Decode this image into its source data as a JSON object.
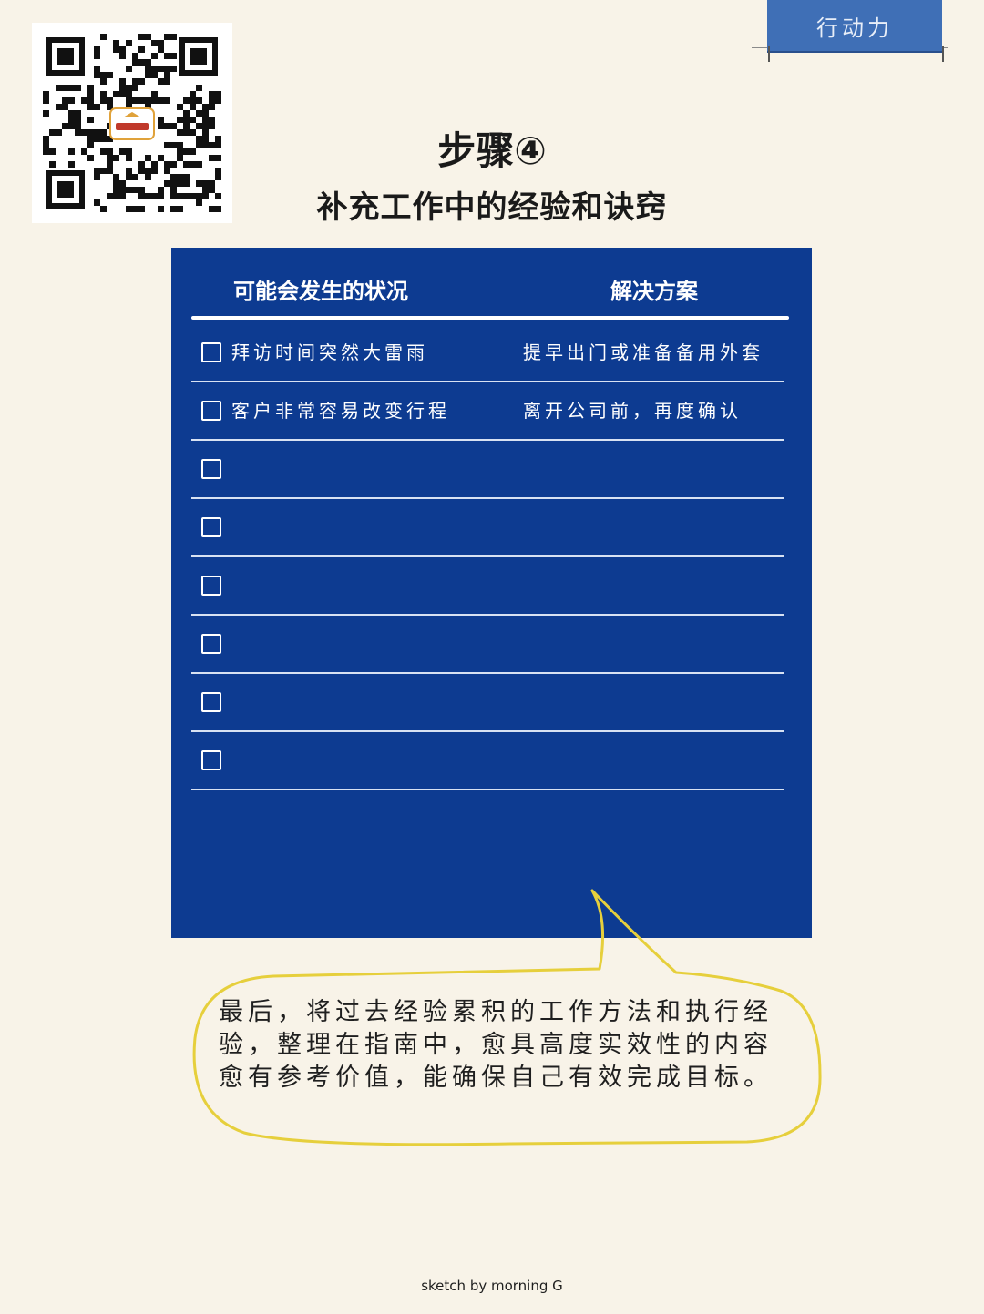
{
  "tag": {
    "label": "行动力"
  },
  "header": {
    "title": "步骤④",
    "subtitle": "补充工作中的经验和诀窍"
  },
  "table": {
    "col_situation": "可能会发生的状况",
    "col_solution": "解决方案",
    "rows": [
      {
        "situation": "拜访时间突然大雷雨",
        "solution": "提早出门或准备备用外套"
      },
      {
        "situation": "客户非常容易改变行程",
        "solution": "离开公司前，再度确认"
      },
      {
        "situation": "",
        "solution": ""
      },
      {
        "situation": "",
        "solution": ""
      },
      {
        "situation": "",
        "solution": ""
      },
      {
        "situation": "",
        "solution": ""
      },
      {
        "situation": "",
        "solution": ""
      },
      {
        "situation": "",
        "solution": ""
      }
    ]
  },
  "bubble": {
    "text": "最后，将过去经验累积的工作方法和执行经验，整理在指南中，愈具高度实效性的内容愈有参考价值，能确保自己有效完成目标。"
  },
  "footer": {
    "credit": "sketch by morning G"
  },
  "colors": {
    "background": "#f8f3e8",
    "board": "#0d3b91",
    "tag": "#3f6fb6",
    "bubble_outline": "#e6cf3c"
  },
  "icons": [
    "qr-code-icon",
    "checkbox-icon"
  ]
}
